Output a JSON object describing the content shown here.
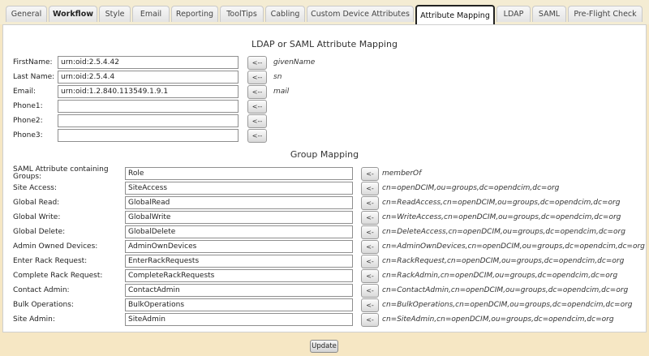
{
  "tabs": [
    "General",
    "Workflow",
    "Style",
    "Email",
    "Reporting",
    "ToolTips",
    "Cabling",
    "Custom Device Attributes",
    "Attribute Mapping",
    "LDAP",
    "SAML",
    "Pre-Flight Check"
  ],
  "mapping": {
    "title": "LDAP or SAML Attribute Mapping",
    "rows": [
      {
        "label": "FirstName:",
        "value": "urn:oid:2.5.4.42",
        "button": "<--",
        "hint": "givenName"
      },
      {
        "label": "Last Name:",
        "value": "urn:oid:2.5.4.4",
        "button": "<--",
        "hint": "sn"
      },
      {
        "label": "Email:",
        "value": "urn:oid:1.2.840.113549.1.9.1",
        "button": "<--",
        "hint": "mail"
      },
      {
        "label": "Phone1:",
        "value": "",
        "button": "<--",
        "hint": ""
      },
      {
        "label": "Phone2:",
        "value": "",
        "button": "<--",
        "hint": ""
      },
      {
        "label": "Phone3:",
        "value": "",
        "button": "<--",
        "hint": ""
      }
    ]
  },
  "groups": {
    "title": "Group Mapping",
    "rows": [
      {
        "label": "SAML Attribute containing Groups:",
        "value": "Role",
        "button": "<-",
        "hint": "memberOf"
      },
      {
        "label": "Site Access:",
        "value": "SiteAccess",
        "button": "<-",
        "hint": "cn=openDCIM,ou=groups,dc=opendcim,dc=org"
      },
      {
        "label": "Global Read:",
        "value": "GlobalRead",
        "button": "<-",
        "hint": "cn=ReadAccess,cn=openDCIM,ou=groups,dc=opendcim,dc=org"
      },
      {
        "label": "Global Write:",
        "value": "GlobalWrite",
        "button": "<-",
        "hint": "cn=WriteAccess,cn=openDCIM,ou=groups,dc=opendcim,dc=org"
      },
      {
        "label": "Global Delete:",
        "value": "GlobalDelete",
        "button": "<-",
        "hint": "cn=DeleteAccess,cn=openDCIM,ou=groups,dc=opendcim,dc=org"
      },
      {
        "label": "Admin Owned Devices:",
        "value": "AdminOwnDevices",
        "button": "<-",
        "hint": "cn=AdminOwnDevices,cn=openDCIM,ou=groups,dc=opendcim,dc=org"
      },
      {
        "label": "Enter Rack Request:",
        "value": "EnterRackRequests",
        "button": "<-",
        "hint": "cn=RackRequest,cn=openDCIM,ou=groups,dc=opendcim,dc=org"
      },
      {
        "label": "Complete Rack Request:",
        "value": "CompleteRackRequests",
        "button": "<-",
        "hint": "cn=RackAdmin,cn=openDCIM,ou=groups,dc=opendcim,dc=org"
      },
      {
        "label": "Contact Admin:",
        "value": "ContactAdmin",
        "button": "<-",
        "hint": "cn=ContactAdmin,cn=openDCIM,ou=groups,dc=opendcim,dc=org"
      },
      {
        "label": "Bulk Operations:",
        "value": "BulkOperations",
        "button": "<-",
        "hint": "cn=BulkOperations,cn=openDCIM,ou=groups,dc=opendcim,dc=org"
      },
      {
        "label": "Site Admin:",
        "value": "SiteAdmin",
        "button": "<-",
        "hint": "cn=SiteAdmin,cn=openDCIM,ou=groups,dc=opendcim,dc=org"
      }
    ]
  },
  "update_label": "Update"
}
